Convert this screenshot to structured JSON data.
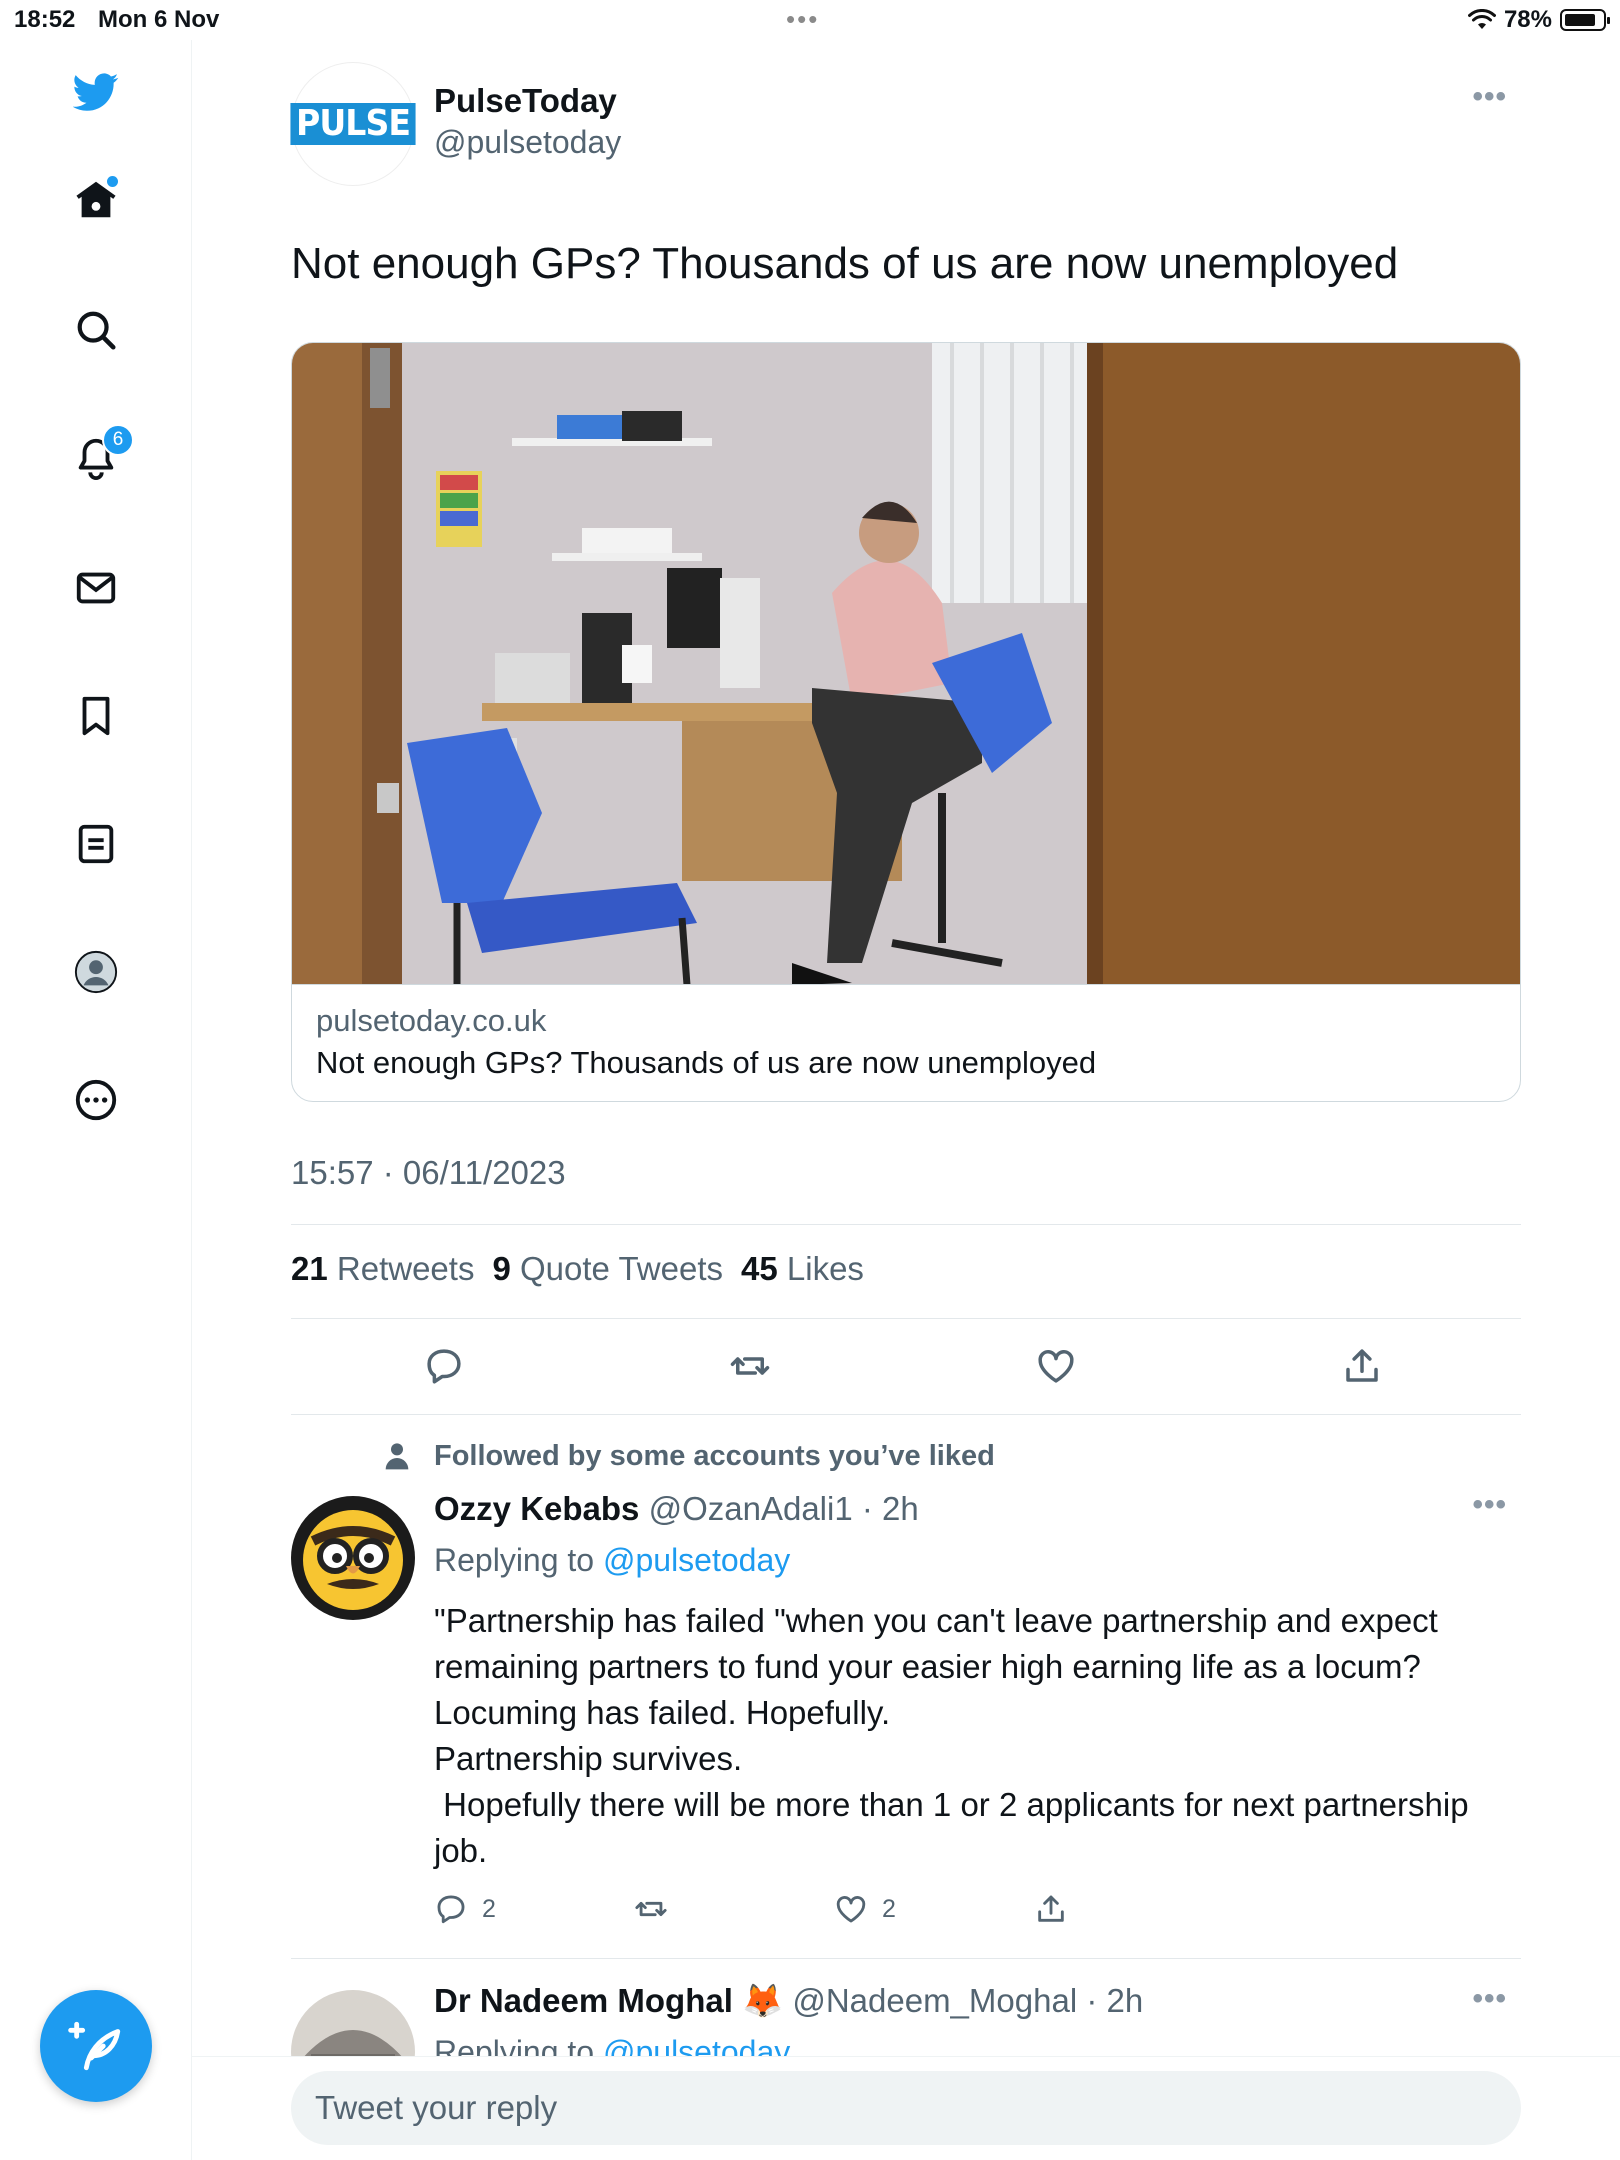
{
  "status_bar": {
    "time": "18:52",
    "date": "Mon 6 Nov",
    "battery": "78%"
  },
  "sidebar": {
    "items": [
      {
        "icon": "twitter-bird-icon"
      },
      {
        "icon": "home-icon",
        "has_dot": true
      },
      {
        "icon": "search-icon"
      },
      {
        "icon": "bell-icon",
        "badge": "6"
      },
      {
        "icon": "mail-icon"
      },
      {
        "icon": "bookmark-icon"
      },
      {
        "icon": "lists-icon"
      },
      {
        "icon": "profile-icon"
      },
      {
        "icon": "more-circle-icon"
      }
    ],
    "compose_icon": "compose-feather-icon"
  },
  "tweet": {
    "author": {
      "name": "PulseToday",
      "handle": "@pulsetoday",
      "logo_text": "PULSE"
    },
    "text": "Not enough GPs? Thousands of us are now unemployed",
    "card": {
      "domain": "pulsetoday.co.uk",
      "title": "Not enough GPs? Thousands of us are now unemployed"
    },
    "timestamp": "15:57 · 06/11/2023",
    "stats": {
      "retweets": "21",
      "retweets_label": "Retweets",
      "quotes": "9",
      "quotes_label": "Quote Tweets",
      "likes": "45",
      "likes_label": "Likes"
    }
  },
  "social_context": "Followed by some accounts you’ve liked",
  "replies": [
    {
      "name": "Ozzy Kebabs",
      "handle": "@OzanAdali1",
      "time": "· 2h",
      "replying_prefix": "Replying to",
      "replying_to": "@pulsetoday",
      "body": "\"Partnership has failed \"when you can't leave partnership and expect remaining partners to fund your easier high earning life as a locum?\nLocuming has failed. Hopefully.\nPartnership survives.\n Hopefully there will be more than 1 or 2 applicants for next partnership job.",
      "reply_count": "2",
      "like_count": "2"
    },
    {
      "name": "Dr Nadeem Moghal",
      "emoji": "🦊",
      "handle": "@Nadeem_Moghal",
      "time": "· 2h",
      "replying_prefix": "Replying to",
      "replying_to": "@pulsetoday"
    }
  ],
  "reply_bar": {
    "placeholder": "Tweet your reply"
  },
  "colors": {
    "accent": "#1d9bf0",
    "muted": "#536471",
    "text": "#0f1419"
  }
}
